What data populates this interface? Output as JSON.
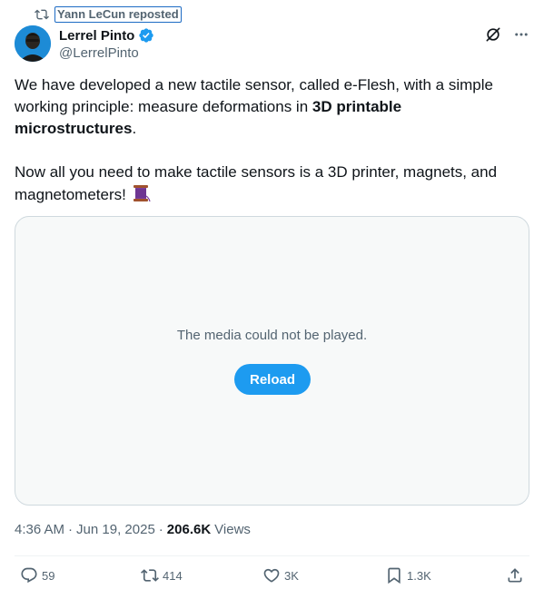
{
  "repost": {
    "label": "Yann LeCun reposted",
    "icon": "repost-icon"
  },
  "author": {
    "display_name": "Lerrel Pinto",
    "handle": "@LerrelPinto",
    "verified": true,
    "avatar_color": "#1d8bd6"
  },
  "tweet": {
    "para1_a": "We have developed a new tactile sensor, called e-Flesh, with a simple working principle: measure deformations in ",
    "para1_bold": "3D printable microstructures",
    "para1_end": ".",
    "para2": "Now all you need to make tactile sensors is a 3D printer, magnets, and magnetometers! ",
    "emoji": "spool-of-thread"
  },
  "media": {
    "message": "The media could not be played.",
    "reload_label": "Reload"
  },
  "meta": {
    "time": "4:36 AM",
    "separator": "·",
    "date": "Jun 19, 2025",
    "separator2": "·",
    "views_count": "206.6K",
    "views_label": "Views"
  },
  "actions": {
    "replies": "59",
    "reposts": "414",
    "likes": "3K",
    "bookmarks": "1.3K"
  },
  "colors": {
    "accent": "#1d9bf0",
    "secondary_text": "#536471",
    "primary_text": "#0f1419"
  }
}
